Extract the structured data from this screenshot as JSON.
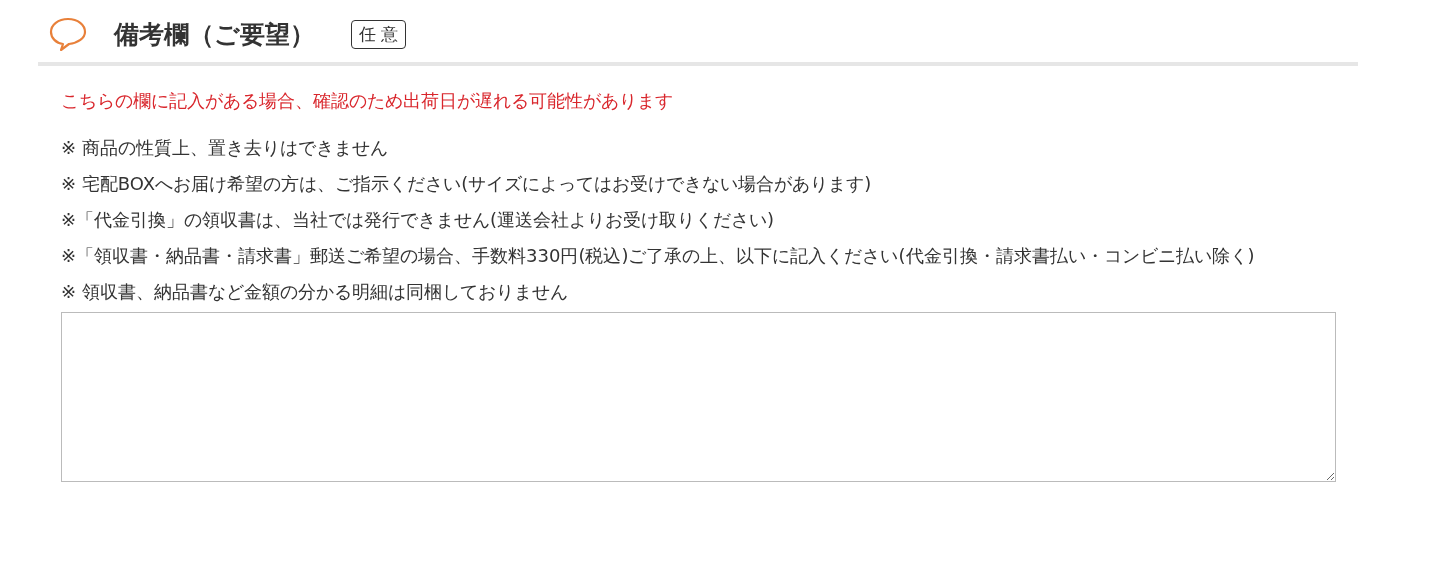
{
  "header": {
    "title": "備考欄（ご要望）",
    "badge": "任 意"
  },
  "warning": "こちらの欄に記入がある場合、確認のため出荷日が遅れる可能性があります",
  "notes": [
    "※ 商品の性質上、置き去りはできません",
    "※ 宅配BOXへお届け希望の方は、ご指示ください(サイズによってはお受けできない場合があります)",
    "※「代金引換」の領収書は、当社では発行できません(運送会社よりお受け取りください)",
    "※「領収書・納品書・請求書」郵送ご希望の場合、手数料330円(税込)ご了承の上、以下に記入ください(代金引換・請求書払い・コンビニ払い除く)",
    "※ 領収書、納品書など金額の分かる明細は同梱しておりません"
  ],
  "remarks_field": {
    "kind": "textarea"
  }
}
